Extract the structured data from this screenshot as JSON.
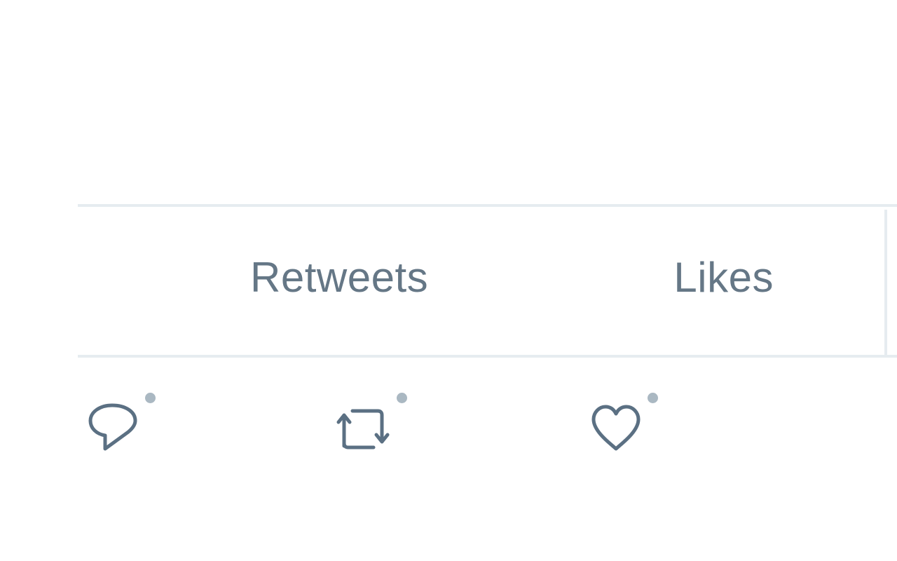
{
  "stats": {
    "retweets_label": "Retweets",
    "likes_label": "Likes"
  },
  "actions": [
    {
      "name": "reply",
      "icon": "reply-icon"
    },
    {
      "name": "retweet",
      "icon": "retweet-icon"
    },
    {
      "name": "like",
      "icon": "heart-icon"
    }
  ],
  "colors": {
    "text_secondary": "#657786",
    "border": "#e6ecf0",
    "dot": "#aab8c2",
    "icon": "#5b7083"
  }
}
